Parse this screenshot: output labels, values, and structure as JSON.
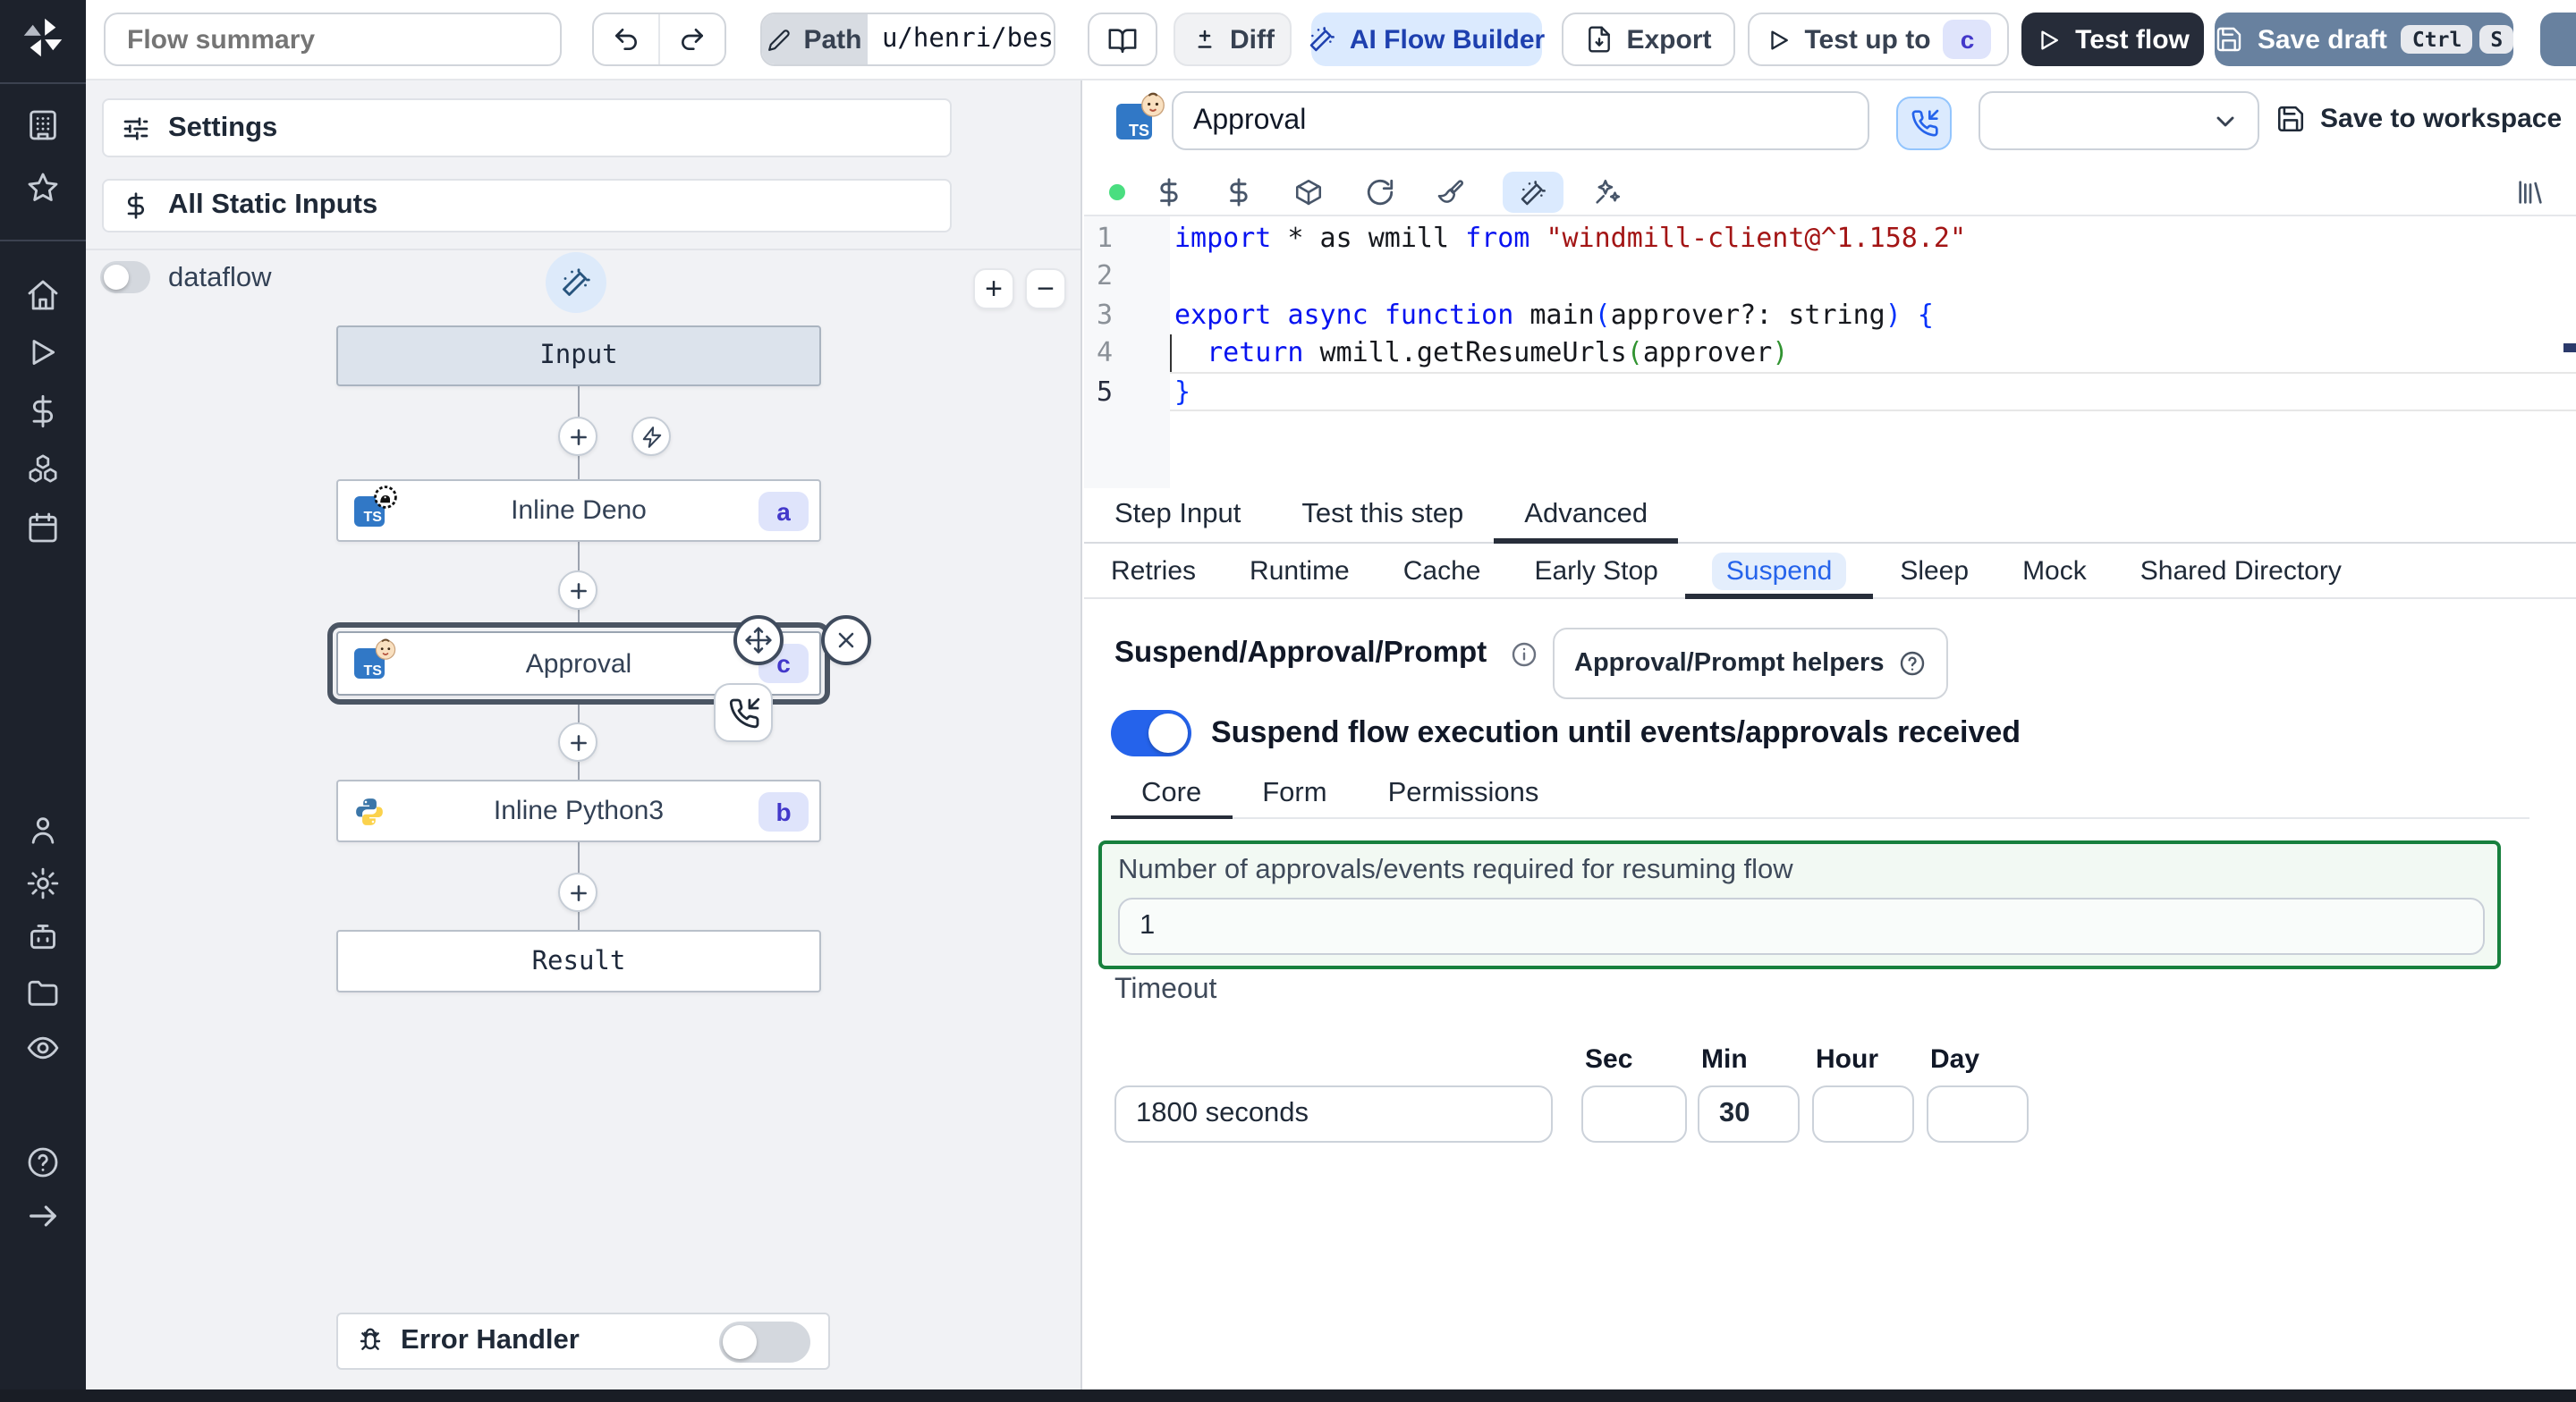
{
  "colors": {
    "sidebar_bg": "#1d222c",
    "accent_blue": "#2563eb",
    "ai_button_bg": "#dbeafe",
    "test_flow_bg": "#262c39",
    "save_draft_bg": "#68819f",
    "badge_bg": "#dfe4fb",
    "badge_text": "#4338ca",
    "suspend_green_border": "#17803d",
    "code_keyword": "#0813f0",
    "code_string": "#a31515"
  },
  "sidebar": {
    "icons": [
      "windmill-logo",
      "apps-grid-icon",
      "star-icon",
      "home-icon",
      "play-icon",
      "dollar-icon",
      "boxes-icon",
      "calendar-icon",
      "user-icon",
      "gear-icon",
      "robot-icon",
      "folder-icon",
      "eye-icon",
      "help-icon",
      "arrow-right-icon"
    ]
  },
  "toolbar": {
    "flow_summary": {
      "placeholder": "Flow summary"
    },
    "undo_icon": "undo-arrow",
    "redo_icon": "redo-arrow",
    "path": {
      "label": "Path",
      "value": "u/henri/bes"
    },
    "book_button": "book-open-icon",
    "diff_label": "Diff",
    "ai_flow_builder_label": "AI Flow Builder",
    "export_label": "Export",
    "test_up_to": {
      "label": "Test up to",
      "badge": "c"
    },
    "test_flow_label": "Test flow",
    "save_draft": {
      "label": "Save draft",
      "kbd_1": "Ctrl",
      "kbd_2": "S"
    }
  },
  "flow_panel": {
    "settings_label": "Settings",
    "all_static_inputs_label": "All Static Inputs",
    "dataflow_label": "dataflow",
    "zoom_in": "+",
    "zoom_out": "−",
    "nodes": {
      "input_label": "Input",
      "steps": [
        {
          "label": "Inline Deno",
          "badge": "a",
          "lang": "deno"
        },
        {
          "label": "Approval",
          "badge": "c",
          "lang": "bun",
          "selected": true
        },
        {
          "label": "Inline Python3",
          "badge": "b",
          "lang": "python"
        }
      ],
      "result_label": "Result"
    },
    "error_handler_label": "Error Handler"
  },
  "step_editor": {
    "ts_logo_text": "TS",
    "name_value": "Approval",
    "language_select_value": "",
    "save_to_workspace_label": "Save to workspace",
    "code": {
      "lines": [
        {
          "num": "1",
          "tokens": [
            {
              "t": "import",
              "c": "tok-kw"
            },
            {
              "t": " * as wmill ",
              "c": "tok-pl"
            },
            {
              "t": "from",
              "c": "tok-kw"
            },
            {
              "t": " ",
              "c": "tok-pl"
            },
            {
              "t": "\"windmill-client@^1.158.2\"",
              "c": "tok-str"
            }
          ]
        },
        {
          "num": "2",
          "tokens": []
        },
        {
          "num": "3",
          "tokens": [
            {
              "t": "export",
              "c": "tok-kw"
            },
            {
              "t": " ",
              "c": "tok-pl"
            },
            {
              "t": "async",
              "c": "tok-kw"
            },
            {
              "t": " ",
              "c": "tok-pl"
            },
            {
              "t": "function",
              "c": "tok-kw"
            },
            {
              "t": " main",
              "c": "tok-pl"
            },
            {
              "t": "(",
              "c": "tok-br1"
            },
            {
              "t": "approver?: string",
              "c": "tok-pl"
            },
            {
              "t": ")",
              "c": "tok-br1"
            },
            {
              "t": " ",
              "c": "tok-pl"
            },
            {
              "t": "{",
              "c": "tok-br1"
            }
          ]
        },
        {
          "num": "4",
          "tokens": [
            {
              "t": "  ",
              "c": "tok-pl"
            },
            {
              "t": "return",
              "c": "tok-kw"
            },
            {
              "t": " wmill.getResumeUrls",
              "c": "tok-pl"
            },
            {
              "t": "(",
              "c": "tok-br2"
            },
            {
              "t": "approver",
              "c": "tok-pl"
            },
            {
              "t": ")",
              "c": "tok-br2"
            }
          ]
        },
        {
          "num": "5",
          "tokens": [
            {
              "t": "}",
              "c": "tok-br1"
            }
          ]
        }
      ]
    },
    "tabs": {
      "items": [
        {
          "label": "Step Input"
        },
        {
          "label": "Test this step"
        },
        {
          "label": "Advanced"
        }
      ]
    },
    "advanced_tabs": {
      "items": [
        {
          "label": "Retries"
        },
        {
          "label": "Runtime"
        },
        {
          "label": "Cache"
        },
        {
          "label": "Early Stop"
        },
        {
          "label": "Suspend"
        },
        {
          "label": "Sleep"
        },
        {
          "label": "Mock"
        },
        {
          "label": "Shared Directory"
        }
      ]
    }
  },
  "suspend_section": {
    "title": "Suspend/Approval/Prompt",
    "helpers_button_label": "Approval/Prompt helpers",
    "toggle_label": "Suspend flow execution until events/approvals received",
    "sub_tabs": {
      "items": [
        {
          "label": "Core"
        },
        {
          "label": "Form"
        },
        {
          "label": "Permissions"
        }
      ]
    },
    "required_events": {
      "label": "Number of approvals/events required for resuming flow",
      "value": "1"
    },
    "timeout": {
      "label": "Timeout",
      "main_value": "1800 seconds",
      "units": [
        {
          "label": "Sec",
          "value": ""
        },
        {
          "label": "Min",
          "value": "30"
        },
        {
          "label": "Hour",
          "value": ""
        },
        {
          "label": "Day",
          "value": ""
        }
      ]
    }
  }
}
